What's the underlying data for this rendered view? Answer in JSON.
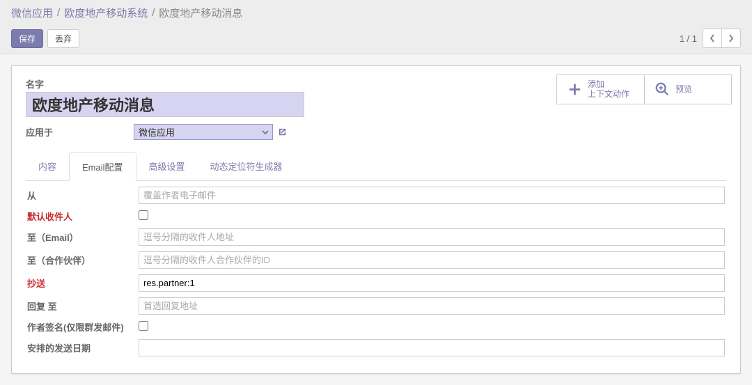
{
  "breadcrumb": {
    "root": "微信应用",
    "parent": "欧度地产移动系统",
    "current": "欧度地产移动消息"
  },
  "buttons": {
    "save": "保存",
    "discard": "丢弃"
  },
  "pager": {
    "value": "1 / 1"
  },
  "stat": {
    "add_line1": "添加",
    "add_line2": "上下文动作",
    "preview": "预览"
  },
  "title": {
    "label": "名字",
    "value": "欧度地产移动消息"
  },
  "applies_to": {
    "label": "应用于",
    "value": "微信应用"
  },
  "tabs": {
    "content": "内容",
    "email": "Email配置",
    "advanced": "高级设置",
    "dyngen": "动态定位符生成器"
  },
  "email": {
    "from_label": "从",
    "from_placeholder": "覆盖作者电子邮件",
    "default_to_label": "默认收件人",
    "to_email_label": "至（Email）",
    "to_email_placeholder": "逗号分隔的收件人地址",
    "to_partner_label": "至（合作伙伴）",
    "to_partner_placeholder": "逗号分隔的收件人合作伙伴的ID",
    "cc_label": "抄送",
    "cc_value": "res.partner:1",
    "reply_to_label": "回复 至",
    "reply_to_placeholder": "首选回复地址",
    "author_sig_label": "作者签名(仅限群发邮件)",
    "schedule_label": "安排的发送日期"
  }
}
